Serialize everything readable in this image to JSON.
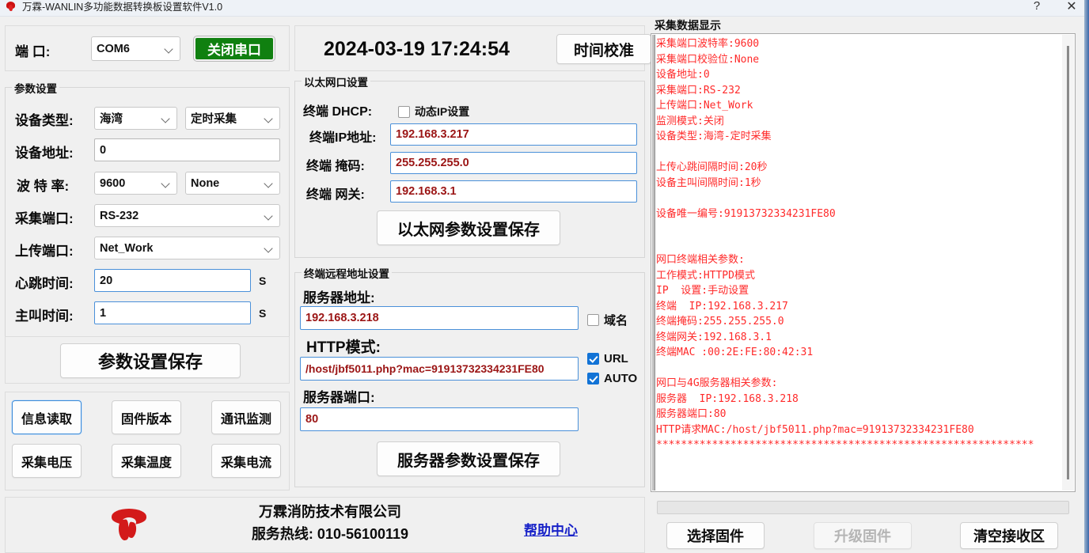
{
  "window": {
    "title": "万霖-WANLIN多功能数据转换板设置软件V1.0",
    "help_btn": "?",
    "close_btn": "✕"
  },
  "port": {
    "label": "端  口:",
    "value": "COM6",
    "close_serial_btn": "关闭串口"
  },
  "params": {
    "group_title": "参数设置",
    "device_type_label": "设备类型:",
    "device_type_value": "海湾",
    "collect_mode_value": "定时采集",
    "device_addr_label": "设备地址:",
    "device_addr_value": "0",
    "baud_label": "波 特 率:",
    "baud_value": "9600",
    "parity_value": "None",
    "collect_port_label": "采集端口:",
    "collect_port_value": "RS-232",
    "upload_port_label": "上传端口:",
    "upload_port_value": "Net_Work",
    "heartbeat_label": "心跳时间:",
    "heartbeat_value": "20",
    "heartbeat_unit": "S",
    "calltime_label": "主叫时间:",
    "calltime_value": "1",
    "calltime_unit": "S",
    "save_btn": "参数设置保存"
  },
  "actions": {
    "info_read": "信息读取",
    "firmware_version": "固件版本",
    "comm_monitor": "通讯监测",
    "collect_voltage": "采集电压",
    "collect_temperature": "采集温度",
    "collect_current": "采集电流"
  },
  "clock": {
    "datetime": "2024-03-19 17:24:54",
    "calibrate_btn": "时间校准"
  },
  "ethernet": {
    "group_title": "以太网口设置",
    "dhcp_label": "终端 DHCP:",
    "dhcp_checkbox_label": "动态IP设置",
    "dhcp_checked": false,
    "ip_label": "终端IP地址:",
    "ip_value": "192.168.3.217",
    "mask_label": "终端   掩码:",
    "mask_value": "255.255.255.0",
    "gateway_label": "终端   网关:",
    "gateway_value": "192.168.3.1",
    "save_btn": "以太网参数设置保存"
  },
  "remote": {
    "group_title": "终端远程地址设置",
    "server_addr_label": "服务器地址:",
    "server_addr_value": "192.168.3.218",
    "domain_checkbox_label": "域名",
    "domain_checked": false,
    "http_mode_label": "HTTP模式:",
    "http_mode_value": "/host/jbf5011.php?mac=91913732334231FE80",
    "url_checkbox_label": "URL",
    "url_checked": true,
    "auto_checkbox_label": "AUTO",
    "auto_checked": true,
    "server_port_label": "服务器端口:",
    "server_port_value": "80",
    "save_btn": "服务器参数设置保存"
  },
  "datadisplay": {
    "group_title": "采集数据显示",
    "text": "采集端口波特率:9600\n采集端口校验位:None\n设备地址:0\n采集端口:RS-232\n上传端口:Net_Work\n监测模式:关闭\n设备类型:海湾-定时采集\n\n上传心跳间隔时间:20秒\n设备主叫间隔时间:1秒\n\n设备唯一编号:91913732334231FE80\n\n\n网口终端相关参数:\n工作模式:HTTPD模式\nIP  设置:手动设置\n终端  IP:192.168.3.217\n终端掩码:255.255.255.0\n终端网关:192.168.3.1\n终端MAC :00:2E:FE:80:42:31\n\n网口与4G服务器相关参数:\n服务器  IP:192.168.3.218\n服务器端口:80\nHTTP请求MAC:/host/jbf5011.php?mac=91913732334231FE80\n*************************************************************"
  },
  "firmware": {
    "select_btn": "选择固件",
    "upgrade_btn": "升级固件",
    "clear_btn": "清空接收区"
  },
  "brand": {
    "company": "万霖消防技术有限公司",
    "hotline": "服务热线: 010-56100119",
    "help_center": "帮助中心"
  },
  "colors": {
    "accent_blue": "#1273d6",
    "green_button": "#108010",
    "data_red": "#ff2a2a",
    "value_red": "#9b1515",
    "link_blue": "#1822c8"
  }
}
